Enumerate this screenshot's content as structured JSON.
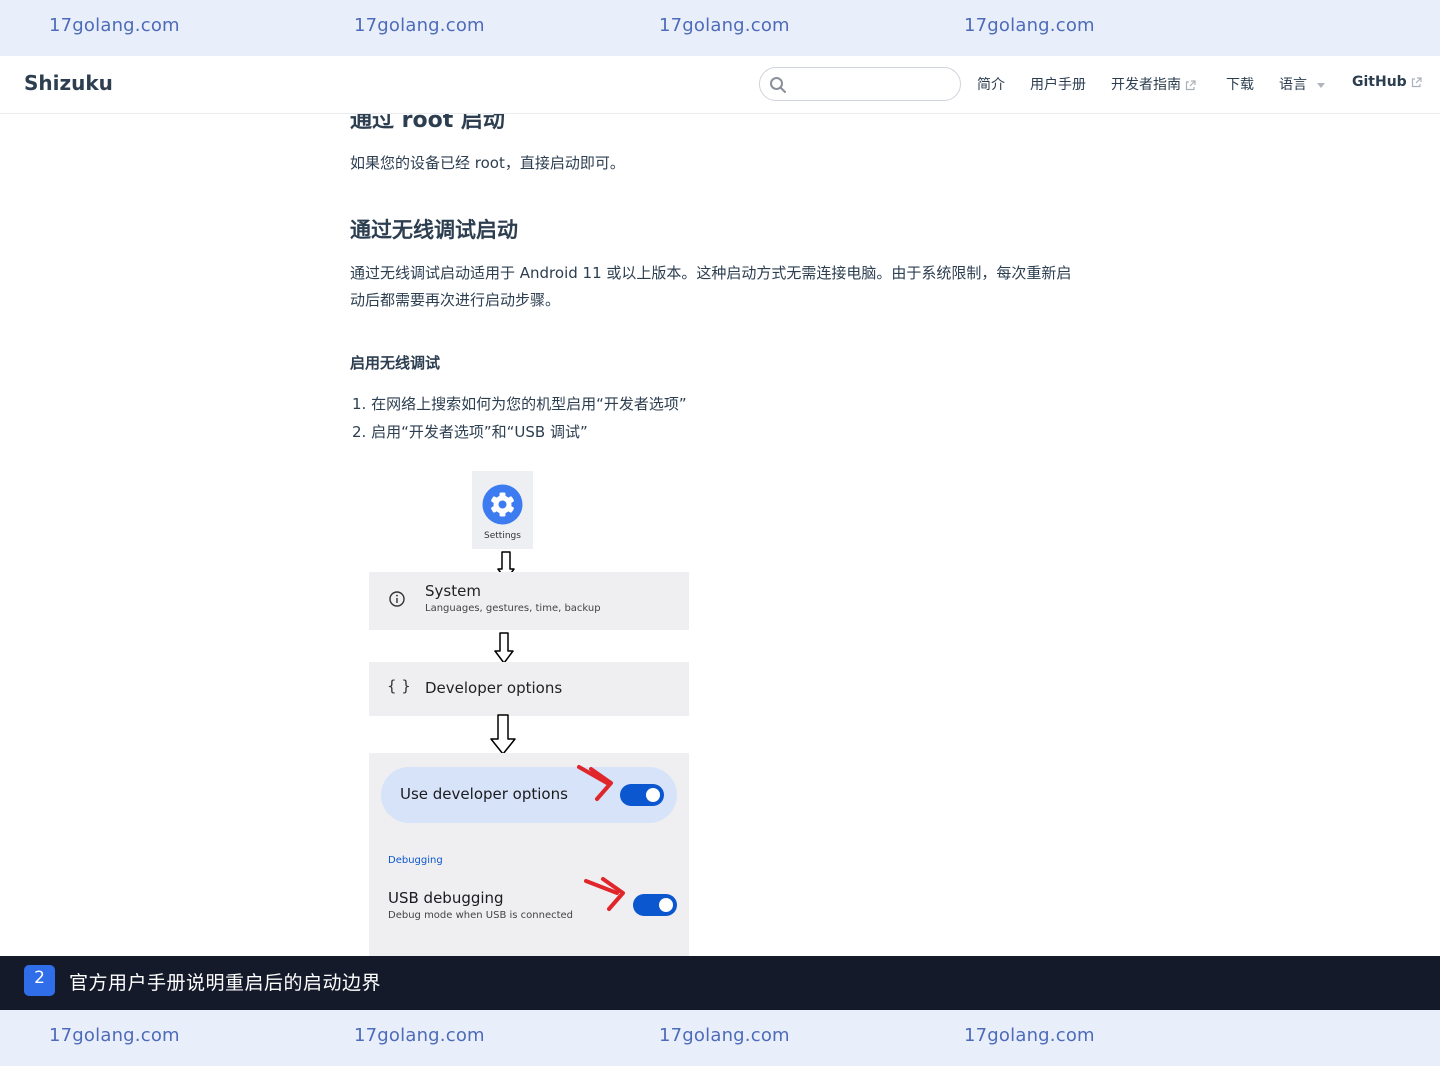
{
  "watermark": {
    "text": "17golang.com"
  },
  "navbar": {
    "site_name": "Shizuku",
    "search": {
      "value": "",
      "placeholder": ""
    },
    "links": {
      "intro": "简介",
      "user_manual": "用户手册",
      "dev_guide": "开发者指南",
      "download": "下载",
      "language": "语言",
      "github": "GitHub"
    }
  },
  "content": {
    "partial_heading": "通过 root 启动",
    "root_paragraph": "如果您的设备已经 root，直接启动即可。",
    "wireless_heading": "通过无线调试启动",
    "wireless_paragraph": "通过无线调试启动适用于 Android 11 或以上版本。这种启动方式无需连接电脑。由于系统限制，每次重新启动后都需要再次进行启动步骤。",
    "enable_heading": "启用无线调试",
    "steps": [
      "1. 在网络上搜索如何为您的机型启用“开发者选项”",
      "2. 启用“开发者选项”和“USB 调试”"
    ]
  },
  "illustration": {
    "settings_label": "Settings",
    "system_title": "System",
    "system_subtitle": "Languages, gestures, time, backup",
    "developer_options": "Developer options",
    "braces_glyph": "{ }",
    "use_developer_options": "Use developer options",
    "debugging_section": "Debugging",
    "usb_debugging_title": "USB debugging",
    "usb_debugging_subtitle": "Debug mode when USB is connected",
    "toggles": {
      "use_developer_options": true,
      "usb_debugging": true
    },
    "accent_color": "#0b57d0",
    "annotation_color": "#e0262a"
  },
  "caption": {
    "number": "2",
    "text": "官方用户手册说明重启后的启动边界"
  },
  "colors": {
    "watermark_bar": "#e9eefb",
    "watermark_text": "#4d6bb8",
    "caption_bar": "#151a2b",
    "caption_badge": "#2f6ee8"
  }
}
